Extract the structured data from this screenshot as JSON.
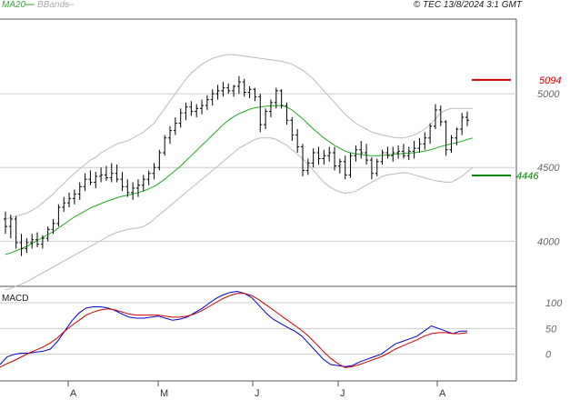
{
  "header": {
    "ma_label": "MA20",
    "bbands_label": "BBands",
    "source": "© TEC 13/8/2024 3:1 GMT"
  },
  "colors": {
    "ma": "#22aa22",
    "bbands": "#bbbbbb",
    "candle": "#000000",
    "resistance": "#cc0000",
    "support": "#008800",
    "macd": "#0000cc",
    "signal": "#cc0000",
    "grid": "#cccccc"
  },
  "chart_data": [
    {
      "type": "line",
      "title": "",
      "months": [
        "A",
        "M",
        "J",
        "J",
        "A"
      ],
      "y_ticks": [
        4000,
        4500,
        5000
      ],
      "ylim": [
        3700,
        5500
      ],
      "resistance": {
        "label": "5094",
        "value": 5094
      },
      "support": {
        "label": "4446",
        "value": 4446
      },
      "ohlc": [
        [
          4150,
          4200,
          4050,
          4100
        ],
        [
          4100,
          4180,
          4020,
          4150
        ],
        [
          4150,
          4170,
          3950,
          3990
        ],
        [
          3990,
          4050,
          3900,
          3950
        ],
        [
          3950,
          4020,
          3920,
          3990
        ],
        [
          3990,
          4050,
          3950,
          4010
        ],
        [
          4010,
          4060,
          3960,
          3980
        ],
        [
          3980,
          4040,
          3950,
          4020
        ],
        [
          4020,
          4100,
          4000,
          4080
        ],
        [
          4080,
          4150,
          4050,
          4120
        ],
        [
          4120,
          4250,
          4100,
          4230
        ],
        [
          4230,
          4300,
          4200,
          4260
        ],
        [
          4260,
          4330,
          4230,
          4290
        ],
        [
          4290,
          4350,
          4250,
          4320
        ],
        [
          4320,
          4400,
          4280,
          4370
        ],
        [
          4370,
          4460,
          4340,
          4420
        ],
        [
          4420,
          4480,
          4380,
          4400
        ],
        [
          4400,
          4470,
          4360,
          4440
        ],
        [
          4440,
          4500,
          4400,
          4450
        ],
        [
          4450,
          4510,
          4410,
          4430
        ],
        [
          4430,
          4530,
          4400,
          4460
        ],
        [
          4460,
          4520,
          4400,
          4420
        ],
        [
          4420,
          4470,
          4340,
          4370
        ],
        [
          4370,
          4420,
          4300,
          4330
        ],
        [
          4330,
          4400,
          4280,
          4360
        ],
        [
          4360,
          4420,
          4300,
          4380
        ],
        [
          4380,
          4450,
          4340,
          4420
        ],
        [
          4420,
          4480,
          4380,
          4460
        ],
        [
          4460,
          4530,
          4420,
          4500
        ],
        [
          4500,
          4620,
          4480,
          4600
        ],
        [
          4600,
          4720,
          4580,
          4700
        ],
        [
          4700,
          4780,
          4660,
          4750
        ],
        [
          4750,
          4840,
          4720,
          4800
        ],
        [
          4800,
          4900,
          4770,
          4870
        ],
        [
          4870,
          4940,
          4820,
          4910
        ],
        [
          4910,
          4950,
          4850,
          4880
        ],
        [
          4880,
          4930,
          4840,
          4900
        ],
        [
          4900,
          4960,
          4860,
          4920
        ],
        [
          4920,
          4990,
          4890,
          4960
        ],
        [
          4960,
          5030,
          4920,
          5000
        ],
        [
          5000,
          5060,
          4960,
          5020
        ],
        [
          5020,
          5080,
          4980,
          5040
        ],
        [
          5040,
          5070,
          5000,
          5020
        ],
        [
          5020,
          5060,
          4980,
          5050
        ],
        [
          5050,
          5120,
          5000,
          5080
        ],
        [
          5080,
          5100,
          4980,
          5010
        ],
        [
          5010,
          5050,
          4970,
          5030
        ],
        [
          5030,
          5040,
          4950,
          4980
        ],
        [
          4980,
          5000,
          4740,
          4790
        ],
        [
          4790,
          4900,
          4760,
          4880
        ],
        [
          4880,
          4960,
          4840,
          4940
        ],
        [
          4940,
          5040,
          4900,
          5020
        ],
        [
          5020,
          5030,
          4900,
          4920
        ],
        [
          4920,
          4940,
          4790,
          4820
        ],
        [
          4820,
          4840,
          4680,
          4720
        ],
        [
          4720,
          4760,
          4600,
          4640
        ],
        [
          4640,
          4660,
          4440,
          4480
        ],
        [
          4480,
          4560,
          4450,
          4530
        ],
        [
          4530,
          4630,
          4500,
          4600
        ],
        [
          4600,
          4640,
          4520,
          4560
        ],
        [
          4560,
          4620,
          4520,
          4580
        ],
        [
          4580,
          4640,
          4540,
          4600
        ],
        [
          4600,
          4640,
          4480,
          4510
        ],
        [
          4510,
          4560,
          4460,
          4540
        ],
        [
          4540,
          4580,
          4420,
          4450
        ],
        [
          4450,
          4600,
          4430,
          4580
        ],
        [
          4580,
          4650,
          4540,
          4620
        ],
        [
          4620,
          4680,
          4560,
          4600
        ],
        [
          4600,
          4660,
          4520,
          4550
        ],
        [
          4550,
          4570,
          4420,
          4460
        ],
        [
          4460,
          4560,
          4440,
          4540
        ],
        [
          4540,
          4620,
          4520,
          4600
        ],
        [
          4600,
          4640,
          4560,
          4580
        ],
        [
          4580,
          4640,
          4540,
          4600
        ],
        [
          4600,
          4650,
          4560,
          4610
        ],
        [
          4610,
          4660,
          4560,
          4580
        ],
        [
          4580,
          4640,
          4550,
          4610
        ],
        [
          4610,
          4680,
          4560,
          4630
        ],
        [
          4630,
          4700,
          4600,
          4660
        ],
        [
          4660,
          4740,
          4620,
          4700
        ],
        [
          4700,
          4800,
          4660,
          4780
        ],
        [
          4780,
          4930,
          4760,
          4890
        ],
        [
          4890,
          4920,
          4780,
          4810
        ],
        [
          4810,
          4820,
          4580,
          4620
        ],
        [
          4620,
          4720,
          4600,
          4700
        ],
        [
          4700,
          4770,
          4650,
          4760
        ],
        [
          4760,
          4870,
          4720,
          4840
        ],
        [
          4840,
          4880,
          4780,
          4820
        ]
      ],
      "ma20": [
        3910,
        3920,
        3935,
        3950,
        3965,
        3985,
        4005,
        4025,
        4045,
        4065,
        4090,
        4115,
        4140,
        4165,
        4185,
        4205,
        4225,
        4240,
        4255,
        4270,
        4282,
        4295,
        4305,
        4312,
        4320,
        4330,
        4340,
        4355,
        4372,
        4395,
        4420,
        4450,
        4480,
        4510,
        4545,
        4580,
        4615,
        4650,
        4685,
        4720,
        4755,
        4790,
        4820,
        4845,
        4865,
        4880,
        4895,
        4905,
        4910,
        4915,
        4918,
        4920,
        4920,
        4910,
        4890,
        4860,
        4830,
        4795,
        4760,
        4730,
        4700,
        4675,
        4650,
        4630,
        4610,
        4600,
        4592,
        4588,
        4583,
        4580,
        4580,
        4582,
        4585,
        4588,
        4592,
        4595,
        4598,
        4600,
        4605,
        4612,
        4620,
        4630,
        4642,
        4652,
        4660,
        4668,
        4678,
        4690,
        4700
      ],
      "bb_upper": [
        4150,
        4160,
        4170,
        4180,
        4190,
        4210,
        4230,
        4260,
        4290,
        4320,
        4360,
        4390,
        4430,
        4460,
        4490,
        4520,
        4550,
        4570,
        4600,
        4620,
        4640,
        4660,
        4670,
        4680,
        4700,
        4720,
        4740,
        4770,
        4800,
        4850,
        4900,
        4950,
        5000,
        5050,
        5100,
        5140,
        5170,
        5200,
        5220,
        5240,
        5250,
        5260,
        5265,
        5265,
        5260,
        5255,
        5250,
        5245,
        5240,
        5235,
        5230,
        5225,
        5220,
        5210,
        5200,
        5180,
        5160,
        5130,
        5100,
        5060,
        5020,
        4980,
        4940,
        4900,
        4860,
        4830,
        4800,
        4780,
        4760,
        4740,
        4730,
        4720,
        4712,
        4705,
        4700,
        4700,
        4710,
        4720,
        4740,
        4760,
        4790,
        4830,
        4870,
        4890,
        4900,
        4900,
        4900,
        4900,
        4900
      ],
      "bb_lower": [
        3670,
        3680,
        3695,
        3710,
        3725,
        3745,
        3765,
        3785,
        3805,
        3825,
        3845,
        3865,
        3885,
        3905,
        3925,
        3945,
        3965,
        3985,
        4005,
        4025,
        4045,
        4060,
        4070,
        4080,
        4085,
        4090,
        4100,
        4120,
        4150,
        4180,
        4210,
        4240,
        4270,
        4300,
        4330,
        4360,
        4390,
        4420,
        4450,
        4480,
        4510,
        4540,
        4570,
        4600,
        4630,
        4650,
        4670,
        4690,
        4700,
        4700,
        4700,
        4690,
        4670,
        4650,
        4620,
        4590,
        4560,
        4520,
        4480,
        4440,
        4400,
        4370,
        4350,
        4335,
        4325,
        4330,
        4340,
        4360,
        4380,
        4400,
        4420,
        4440,
        4450,
        4455,
        4460,
        4465,
        4460,
        4450,
        4440,
        4430,
        4420,
        4410,
        4405,
        4400,
        4400,
        4420,
        4440,
        4470,
        4500
      ]
    },
    {
      "type": "line",
      "title": "MACD",
      "y_ticks": [
        0,
        50,
        100
      ],
      "ylim": [
        -50,
        130
      ],
      "series": [
        {
          "name": "",
          "values": [
            -20,
            -5,
            0,
            2,
            2,
            4,
            6,
            10,
            25,
            45,
            65,
            80,
            90,
            92,
            92,
            90,
            85,
            78,
            72,
            70,
            70,
            72,
            74,
            70,
            66,
            68,
            72,
            80,
            88,
            98,
            108,
            115,
            120,
            122,
            118,
            110,
            95,
            80,
            68,
            60,
            52,
            45,
            35,
            20,
            5,
            -10,
            -20,
            -22,
            -24,
            -22,
            -15,
            -10,
            -5,
            0,
            10,
            20,
            25,
            30,
            35,
            45,
            55,
            50,
            45,
            40,
            45,
            45
          ]
        },
        {
          "name": "",
          "values": [
            -25,
            -18,
            -12,
            -5,
            2,
            8,
            14,
            22,
            32,
            45,
            56,
            66,
            76,
            82,
            86,
            88,
            86,
            82,
            78,
            76,
            76,
            76,
            76,
            74,
            72,
            72,
            74,
            78,
            84,
            92,
            100,
            108,
            114,
            118,
            118,
            114,
            106,
            96,
            86,
            76,
            66,
            56,
            46,
            34,
            20,
            5,
            -8,
            -18,
            -26,
            -24,
            -20,
            -15,
            -10,
            -5,
            2,
            10,
            16,
            22,
            28,
            35,
            40,
            42,
            42,
            40,
            40,
            42
          ]
        }
      ]
    }
  ]
}
